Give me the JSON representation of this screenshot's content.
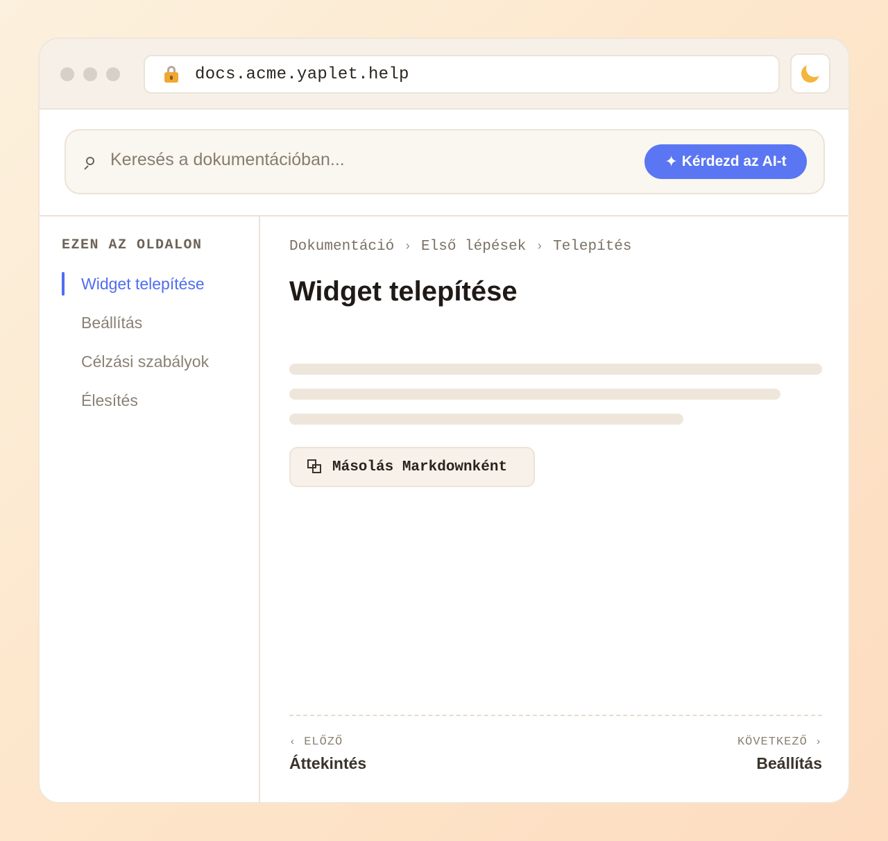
{
  "browser": {
    "url": "docs.acme.yaplet.help",
    "window_dots": [
      "close",
      "minimize",
      "maximize"
    ],
    "icons": {
      "lock": "lock-icon",
      "theme": "moon-icon"
    }
  },
  "search": {
    "placeholder": "Keresés a dokumentációban...",
    "ai_button_label": "Kérdezd az AI-t",
    "ai_button_icon": "✦",
    "accent_color": "#5a76f2"
  },
  "sidebar": {
    "heading": "EZEN AZ OLDALON",
    "items": [
      {
        "label": "Widget telepítése",
        "active": true
      },
      {
        "label": "Beállítás",
        "active": false
      },
      {
        "label": "Célzási szabályok",
        "active": false
      },
      {
        "label": "Élesítés",
        "active": false
      }
    ]
  },
  "main": {
    "breadcrumb": [
      "Dokumentáció",
      "Első lépések",
      "Telepítés"
    ],
    "breadcrumb_separator": "›",
    "title": "Widget telepítése",
    "copy_button_label": "Másolás Markdownként",
    "pager": {
      "prev_caption": "ELŐZŐ",
      "prev_chevron": "‹",
      "prev_title": "Áttekintés",
      "next_caption": "KÖVETKEZŐ",
      "next_chevron": "›",
      "next_title": "Beállítás"
    }
  }
}
